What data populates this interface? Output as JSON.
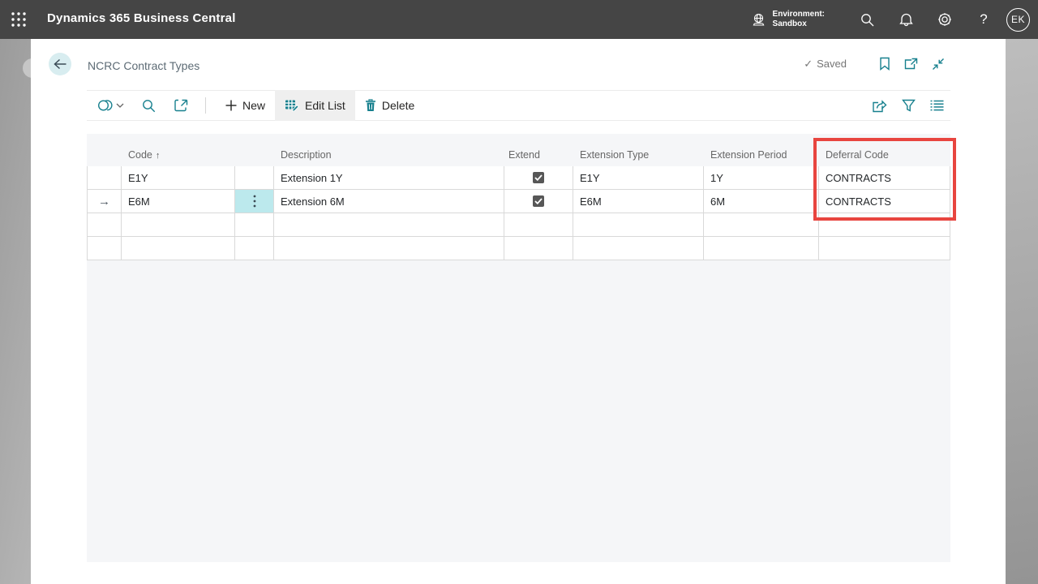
{
  "topbar": {
    "app_title": "Dynamics 365 Business Central",
    "environment_label": "Environment:",
    "environment_name": "Sandbox",
    "help_glyph": "?",
    "avatar_initials": "EK"
  },
  "page": {
    "title": "NCRC Contract Types",
    "save_status": "Saved",
    "save_check_glyph": "✓"
  },
  "toolbar": {
    "new_label": "New",
    "edit_list_label": "Edit List",
    "delete_label": "Delete"
  },
  "table": {
    "columns": {
      "code": "Code",
      "description": "Description",
      "extend": "Extend",
      "extension_type": "Extension Type",
      "extension_period": "Extension Period",
      "deferral_code": "Deferral Code"
    },
    "sort": {
      "column": "Code",
      "direction": "ascending",
      "arrow_glyph": "↑"
    },
    "current_row_glyph": "→",
    "row_menu_glyph": "⋮",
    "rows": [
      {
        "code": "E1Y",
        "description": "Extension 1Y",
        "extend_checked": true,
        "extension_type": "E1Y",
        "extension_period": "1Y",
        "deferral_code": "CONTRACTS",
        "current": false
      },
      {
        "code": "E6M",
        "description": "Extension 6M",
        "extend_checked": true,
        "extension_type": "E6M",
        "extension_period": "6M",
        "deferral_code": "CONTRACTS",
        "current": true
      },
      {
        "code": "",
        "description": "",
        "extend_checked": false,
        "extension_type": "",
        "extension_period": "",
        "deferral_code": "",
        "current": false
      },
      {
        "code": "",
        "description": "",
        "extend_checked": false,
        "extension_type": "",
        "extension_period": "",
        "deferral_code": "",
        "current": false
      }
    ]
  },
  "annotation": {
    "purpose": "highlight of Deferral Code column values",
    "color": "#e8453f"
  },
  "colors": {
    "topbar_bg": "#454545",
    "accent_teal": "#17808e",
    "back_circle_bg": "#d8edf0",
    "active_cell_cyan": "#bce9ed",
    "panel_bg": "#f5f6f8",
    "cell_border": "#d9d9d9",
    "checkbox_fill": "#575757",
    "edit_list_active_bg": "#efefef"
  }
}
